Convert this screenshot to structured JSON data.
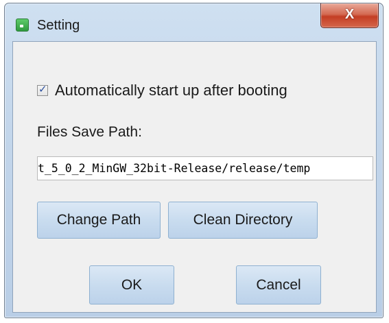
{
  "window": {
    "title": "Setting",
    "close_glyph": "X"
  },
  "settings": {
    "autostart_label": "Automatically start up after booting",
    "autostart_checked": true,
    "files_save_path_label": "Files Save Path:",
    "files_save_path_value": "t_5_0_2_MinGW_32bit-Release/release/temp"
  },
  "buttons": {
    "change_path": "Change Path",
    "clean_directory": "Clean Directory",
    "ok": "OK",
    "cancel": "Cancel"
  },
  "icons": {
    "app": "app-icon",
    "close": "close-icon",
    "check": "checkmark-icon"
  }
}
